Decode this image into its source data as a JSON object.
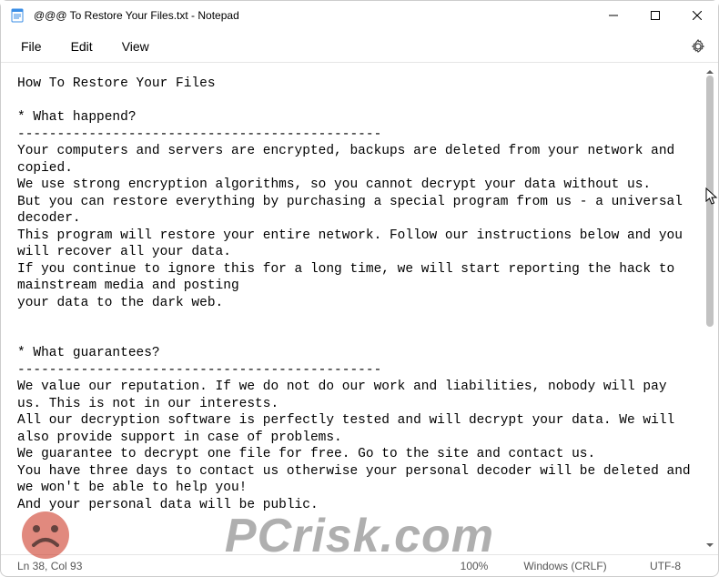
{
  "window": {
    "title": "@@@ To Restore Your Files.txt - Notepad"
  },
  "menu": {
    "file": "File",
    "edit": "Edit",
    "view": "View"
  },
  "document": {
    "text": "How To Restore Your Files\n\n* What happend?\n----------------------------------------------\nYour computers and servers are encrypted, backups are deleted from your network and copied.\nWe use strong encryption algorithms, so you cannot decrypt your data without us.\nBut you can restore everything by purchasing a special program from us - a universal decoder.\nThis program will restore your entire network. Follow our instructions below and you will recover all your data.\nIf you continue to ignore this for a long time, we will start reporting the hack to mainstream media and posting\nyour data to the dark web.\n\n\n* What guarantees?\n----------------------------------------------\nWe value our reputation. If we do not do our work and liabilities, nobody will pay us. This is not in our interests.\nAll our decryption software is perfectly tested and will decrypt your data. We will also provide support in case of problems.\nWe guarantee to decrypt one file for free. Go to the site and contact us.\nYou have three days to contact us otherwise your personal decoder will be deleted and we won't be able to help you!\nAnd your personal data will be public."
  },
  "status": {
    "position": "Ln 38, Col 93",
    "zoom": "100%",
    "line_ending": "Windows (CRLF)",
    "encoding": "UTF-8"
  },
  "watermark": {
    "text": "PCrisk.com"
  }
}
